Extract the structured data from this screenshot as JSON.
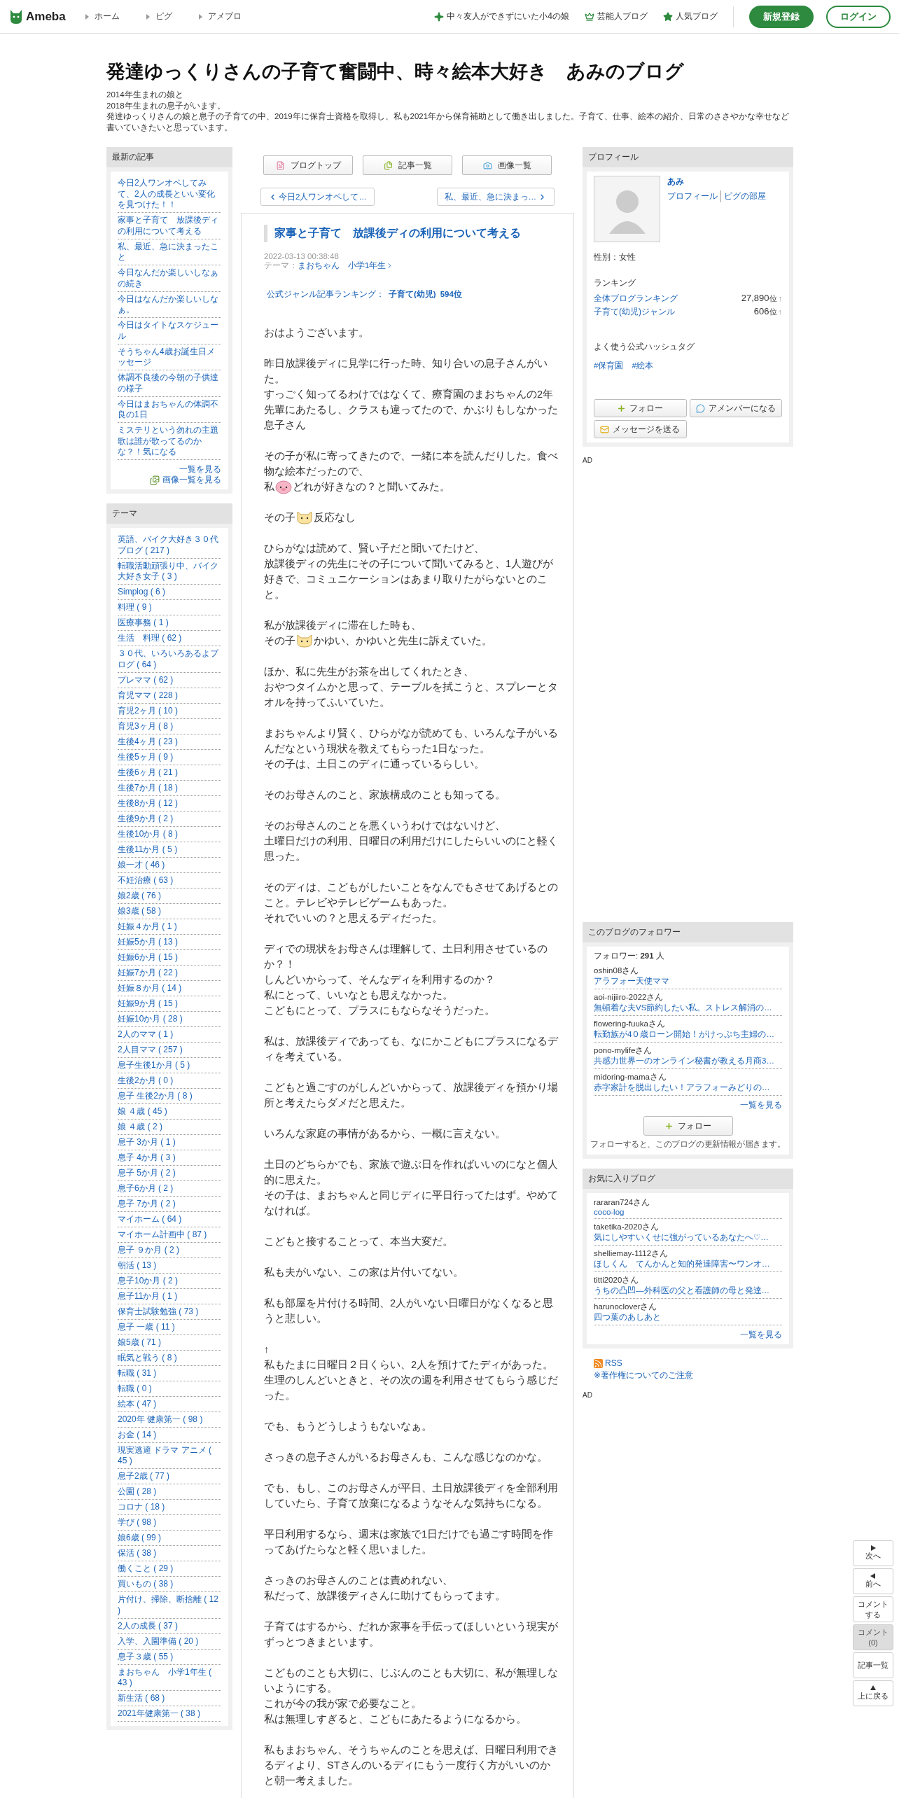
{
  "header": {
    "logo": "Ameba",
    "nav": [
      "ホーム",
      "ピグ",
      "アメブロ"
    ],
    "links": [
      {
        "kind": "sparkle",
        "label": "中々友人ができずにいた小4の娘"
      },
      {
        "kind": "crown",
        "label": "芸能人ブログ"
      },
      {
        "kind": "star",
        "label": "人気ブログ"
      }
    ],
    "signup": "新規登録",
    "login": "ログイン"
  },
  "blog": {
    "title": "発達ゆっくりさんの子育て奮闘中、時々絵本大好き　あみのブログ",
    "description": [
      "2014年生まれの娘と",
      "2018年生まれの息子がいます。",
      "発達ゆっくりさんの娘と息子の子育ての中、2019年に保育士資格を取得し、私も2021年から保育補助として働き出しました。子育て、仕事、絵本の紹介、日常のささやかな幸せなど",
      "書いていきたいと思っています。"
    ]
  },
  "recent": {
    "title": "最新の記事",
    "items": [
      "今日2人ワンオペしてみて、2人の成長といい変化を見つけた！！",
      "家事と子育て　放課後ディの利用について考える",
      "私、最近、急に決まったこと",
      "今日なんだか楽しいしなぁの続き",
      "今日はなんだか楽しいしなぁ。",
      "今日はタイトなスケジュール",
      "そうちゃん4歳お誕生日メッセージ",
      "体調不良後の今朝の子供達の様子",
      "今日はまおちゃんの体調不良の1日",
      "ミステリという勿れの主題歌は誰が歌ってるのかな？！気になる"
    ],
    "more": "一覧を見る",
    "images": "画像一覧を見る"
  },
  "themes": {
    "title": "テーマ",
    "items": [
      "英語、バイク大好き３０代ブログ ( 217 )",
      "転職活動頑張り中、バイク大好き女子 ( 3 )",
      "Simplog ( 6 )",
      "料理 ( 9 )",
      "医療事務 ( 1 )",
      "生活　料理 ( 62 )",
      "３０代、いろいろあるよブログ ( 64 )",
      "プレママ ( 62 )",
      "育児ママ ( 228 )",
      "育児2ヶ月 ( 10 )",
      "育児3ヶ月 ( 8 )",
      "生後4ヶ月 ( 23 )",
      "生後5ヶ月 ( 9 )",
      "生後6ヶ月 ( 21 )",
      "生後7か月 ( 18 )",
      "生後8か月 ( 12 )",
      "生後9か月 ( 2 )",
      "生後10か月 ( 8 )",
      "生後11か月 ( 5 )",
      "娘一才 ( 46 )",
      "不妊治療 ( 63 )",
      "娘2歳 ( 76 )",
      "娘3歳 ( 58 )",
      "妊娠４か月 ( 1 )",
      "妊娠5か月 ( 13 )",
      "妊娠6か月 ( 15 )",
      "妊娠7か月 ( 22 )",
      "妊娠８か月 ( 14 )",
      "妊娠9か月 ( 15 )",
      "妊娠10か月 ( 28 )",
      "2人のママ ( 1 )",
      "2人目ママ ( 257 )",
      "息子生後1か月 ( 5 )",
      "生後2か月 ( 0 )",
      "息子 生後2か月 ( 8 )",
      "娘 ４歳 ( 45 )",
      "娘 ４歳 ( 2 )",
      "息子 3か月 ( 1 )",
      "息子 4か月 ( 3 )",
      "息子 5か月 ( 2 )",
      "息子6か月 ( 2 )",
      "息子 7か月 ( 2 )",
      "マイホーム ( 64 )",
      "マイホーム計画中 ( 87 )",
      "息子 ９か月 ( 2 )",
      "朝活 ( 13 )",
      "息子10か月 ( 2 )",
      "息子11か月 ( 1 )",
      "保育士試験勉強 ( 73 )",
      "息子 一歳 ( 11 )",
      "娘5歳 ( 71 )",
      "眠気と戦う ( 8 )",
      "転職 ( 31 )",
      "転職 ( 0 )",
      "絵本 ( 47 )",
      "2020年 健康第一 ( 98 )",
      "お金 ( 14 )",
      "現実逃避 ドラマ アニメ ( 45 )",
      "息子2歳 ( 77 )",
      "公園 ( 28 )",
      "コロナ ( 18 )",
      "学び ( 98 )",
      "娘6歳 ( 99 )",
      "保活 ( 38 )",
      "働くこと ( 29 )",
      "買いもの ( 38 )",
      "片付け、掃除、断捨離 ( 12 )",
      "2人の成長 ( 37 )",
      "入学、入園準備 ( 20 )",
      "息子３歳 ( 55 )",
      "まおちゃん　小学1年生 ( 43 )",
      "新生活 ( 68 )",
      "2021年健康第一 ( 38 )"
    ]
  },
  "article_nav": {
    "buttons": [
      {
        "kind": "top",
        "label": "ブログトップ"
      },
      {
        "kind": "list",
        "label": "記事一覧"
      },
      {
        "kind": "images",
        "label": "画像一覧"
      }
    ],
    "prev": "今日2人ワンオペして…",
    "next": "私、最近、急に決まっ…"
  },
  "article": {
    "title": "家事と子育て　放課後ディの利用について考える",
    "date": "2022-03-13 00:38:48",
    "theme_label": "テーマ：",
    "theme": "まおちゃん　小学1年生",
    "ranking_label": "公式ジャンル記事ランキング：",
    "ranking_genre": "子育て(幼児)",
    "ranking_rank": "594位",
    "paragraphs": [
      {
        "lines": [
          "おはようございます。"
        ]
      },
      {
        "lines": [
          "昨日放課後ディに見学に行った時、知り合いの息子さんがいた。",
          "すっごく知ってるわけではなくて、療育園のまおちゃんの2年先輩にあたるし、クラスも違ってたので、かぶりもしなかった息子さん"
        ]
      },
      {
        "lines": [
          "その子が私に寄ってきたので、一緒に本を読んだりした。食べ物な絵本だったので、",
          {
            "before": "私",
            "kind": "pig",
            "after": "どれが好きなの？と聞いてみた。"
          }
        ]
      },
      {
        "lines": [
          {
            "before": "その子",
            "kind": "cat",
            "after": "反応なし"
          }
        ]
      },
      {
        "lines": [
          "ひらがなは読めて、賢い子だと聞いてたけど、",
          "放課後ディの先生にその子について聞いてみると、1人遊びが好きで、コミュニケーションはあまり取りたがらないとのこと。"
        ]
      },
      {
        "lines": [
          "私が放課後ディに滞在した時も、",
          {
            "before": "その子",
            "kind": "cat",
            "after": "かゆい、かゆいと先生に訴えていた。"
          }
        ]
      },
      {
        "lines": [
          "ほか、私に先生がお茶を出してくれたとき、",
          "おやつタイムかと思って、テーブルを拭こうと、スプレーとタオルを持ってふいていた。"
        ]
      },
      {
        "lines": [
          "まおちゃんより賢く、ひらがなが読めても、いろんな子がいるんだなという現状を教えてもらった1日なった。",
          "その子は、土日このディに通っているらしい。"
        ]
      },
      {
        "lines": [
          "そのお母さんのこと、家族構成のことも知ってる。"
        ]
      },
      {
        "lines": [
          "そのお母さんのことを悪くいうわけではないけど、",
          "土曜日だけの利用、日曜日の利用だけにしたらいいのにと軽く思った。"
        ]
      },
      {
        "lines": [
          "そのディは、こどもがしたいことをなんでもさせてあげるとのこと。テレビやテレビゲームもあった。",
          "それでいいの？と思えるディだった。"
        ]
      },
      {
        "lines": [
          "ディでの現状をお母さんは理解して、土日利用させているのか？！",
          "しんどいからって、そんなディを利用するのか？",
          "私にとって、いいなとも思えなかった。",
          "こどもにとって、プラスにもならなそうだった。"
        ]
      },
      {
        "lines": [
          "私は、放課後ディであっても、なにかこどもにプラスになるディを考えている。"
        ]
      },
      {
        "lines": [
          "こどもと過ごすのがしんどいからって、放課後ディを預かり場所と考えたらダメだと思えた。"
        ]
      },
      {
        "lines": [
          "いろんな家庭の事情があるから、一概に言えない。"
        ]
      },
      {
        "lines": [
          "土日のどちらかでも、家族で遊ぶ日を作ればいいのになと個人的に思えた。",
          "その子は、まおちゃんと同じディに平日行ってたはず。やめてなければ。"
        ]
      },
      {
        "lines": [
          "こどもと接することって、本当大変だ。"
        ]
      },
      {
        "lines": [
          "私も夫がいない、この家は片付いてない。"
        ]
      },
      {
        "lines": [
          "私も部屋を片付ける時間、2人がいない日曜日がなくなると思うと悲しい。"
        ]
      },
      {
        "lines": [
          "↑",
          "私もたまに日曜日２日くらい、2人を預けてたディがあった。生理のしんどいときと、その次の週を利用させてもらう感じだった。"
        ]
      },
      {
        "lines": [
          "でも、もうどうしようもないなぁ。"
        ]
      },
      {
        "lines": [
          "さっきの息子さんがいるお母さんも、こんな感じなのかな。"
        ]
      },
      {
        "lines": [
          "でも、もし、このお母さんが平日、土日放課後ディを全部利用していたら、子育て放棄になるようなそんな気持ちになる。"
        ]
      },
      {
        "lines": [
          "平日利用するなら、週末は家族で1日だけでも過ごす時間を作ってあげたらなと軽く思いました。"
        ]
      },
      {
        "lines": [
          "さっきのお母さんのことは責めれない、",
          "私だって、放課後ディさんに助けてもらってます。"
        ]
      },
      {
        "lines": [
          "子育てはするから、だれか家事を手伝ってほしいという現実がずっとつきまといます。"
        ]
      },
      {
        "lines": [
          "こどものことも大切に、じぶんのことも大切に、私が無理しないようにする。",
          "これが今の我が家で必要なこと。",
          "私は無理しすぎると、こどもにあたるようになるから。"
        ]
      },
      {
        "lines": [
          "私もまおちゃん、そうちゃんのことを思えば、日曜日利用できるディより、STさんのいるディにもう一度行く方がいいのかと朝一考えました。"
        ]
      }
    ]
  },
  "profile": {
    "title": "プロフィール",
    "name": "あみ",
    "links": [
      "プロフィール",
      "ピグの部屋"
    ],
    "gender": "性別：女性",
    "ranking_title": "ランキング",
    "rankings": [
      {
        "label": "全体ブログランキング",
        "rank": "27,890",
        "unit": "位",
        "arrow": "↑"
      },
      {
        "label": "子育て(幼児)ジャンル",
        "rank": "606",
        "unit": "位",
        "arrow": "↑"
      }
    ],
    "hashtag_title": "よく使う公式ハッシュタグ",
    "hashtags": [
      "#保育園",
      "#絵本"
    ],
    "buttons": [
      {
        "kind": "follow",
        "label": "フォロー"
      },
      {
        "kind": "amember",
        "label": "アメンバーになる"
      },
      {
        "kind": "message",
        "label": "メッセージを送る"
      }
    ]
  },
  "ad_top": "AD",
  "followers": {
    "title": "このブログのフォロワー",
    "count": "フォロワー: **291** 人",
    "items": [
      {
        "user": "oshin08さん",
        "blog": "アラフォー天使ママ"
      },
      {
        "user": "aoi-nijiiro-2022さん",
        "blog": "無頓着な夫VS節約したい私。ストレス解消の…"
      },
      {
        "user": "flowering-fuukaさん",
        "blog": "転勤族が4０歳ローン開始！がけっぷち主婦の…"
      },
      {
        "user": "pono-mylifeさん",
        "blog": "共感力世界一のオンライン秘書が教える月商3…"
      },
      {
        "user": "midoring-mamaさん",
        "blog": "赤字家計を脱出したい！アラフォーみどりの…"
      }
    ],
    "more": "一覧を見る",
    "follow": "フォロー",
    "note": "フォローすると、このブログの更新情報が届きます。"
  },
  "favorites": {
    "title": "お気に入りブログ",
    "items": [
      {
        "user": "rararan724さん",
        "blog": "coco-log"
      },
      {
        "user": "taketika-2020さん",
        "blog": "気にしやすいくせに強がっているあなたへ♡…"
      },
      {
        "user": "shelliemay-1112さん",
        "blog": "ほしくん　てんかんと知的発達障害〜ワンオ…"
      },
      {
        "user": "titti2020さん",
        "blog": "うちの凸凹―外科医の父と看護師の母と発達…"
      },
      {
        "user": "harunocloverさん",
        "blog": "四つ葉のあしあと"
      }
    ],
    "more": "一覧を見る"
  },
  "rss": "RSS",
  "copyright": "※著作権についてのご注意",
  "ad_bottom": "AD",
  "float_nav": [
    {
      "kind": "next",
      "label": "次へ",
      "disabled": false
    },
    {
      "kind": "prev",
      "label": "前へ",
      "disabled": false
    },
    {
      "kind": "comment",
      "label": "コメントする",
      "disabled": false
    },
    {
      "kind": "count",
      "label": "コメント(0)",
      "disabled": true
    },
    {
      "kind": "list",
      "label": "記事一覧",
      "disabled": false
    },
    {
      "kind": "top",
      "label": "上に戻る",
      "disabled": false
    }
  ]
}
